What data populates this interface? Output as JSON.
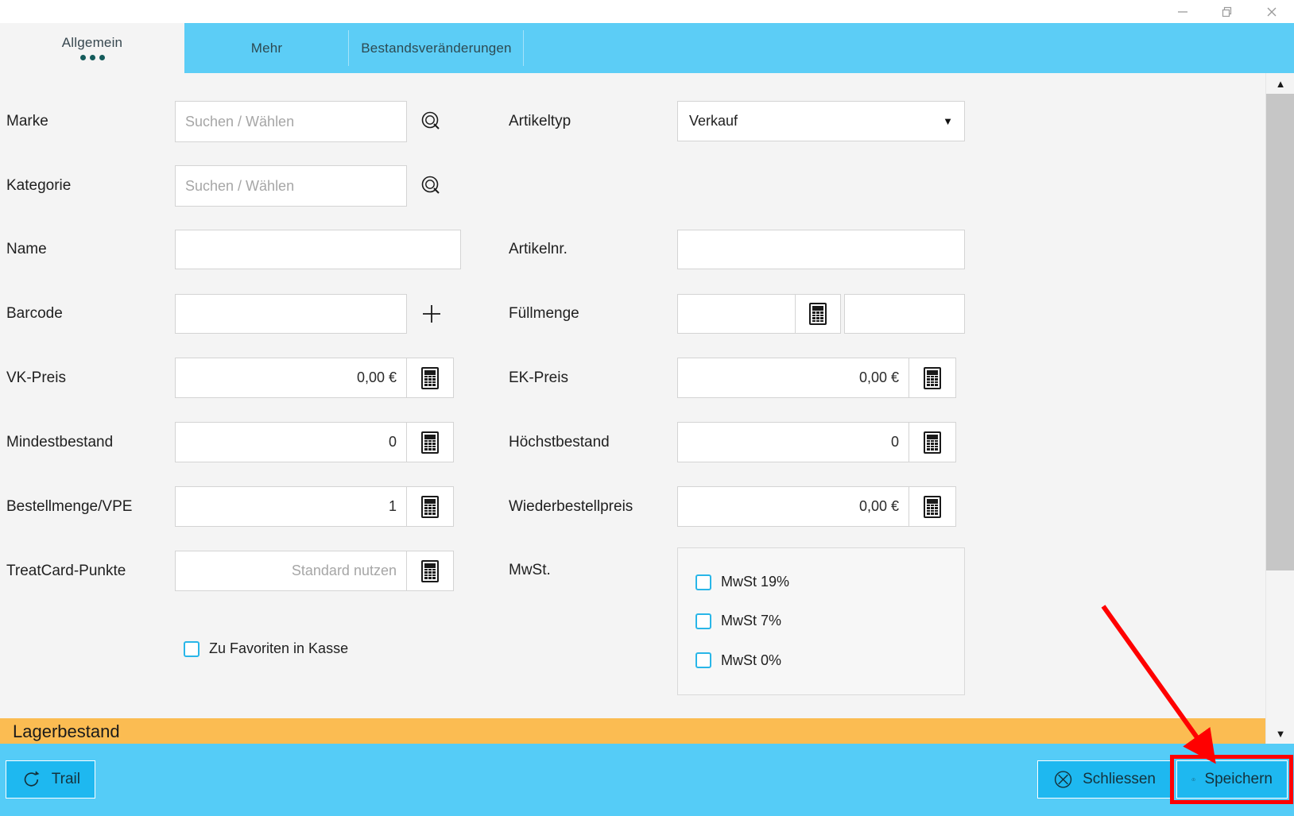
{
  "window": {
    "controls": [
      {
        "name": "minimize",
        "glyph": "minimize-icon"
      },
      {
        "name": "restore",
        "glyph": "restore-icon"
      },
      {
        "name": "close",
        "glyph": "close-icon"
      }
    ]
  },
  "tabs": [
    {
      "label": "Allgemein",
      "active": true,
      "dots": 3
    },
    {
      "label": "Mehr",
      "active": false
    },
    {
      "label": "Bestandsveränderungen",
      "active": false
    }
  ],
  "form": {
    "left": [
      {
        "label": "Marke",
        "value": "",
        "placeholder": "Suchen / Wählen",
        "trailing": "search-icon"
      },
      {
        "label": "Kategorie",
        "value": "",
        "placeholder": "Suchen / Wählen",
        "trailing": "search-icon"
      },
      {
        "label": "Name",
        "value": "",
        "placeholder": ""
      },
      {
        "label": "Barcode",
        "value": "",
        "placeholder": "",
        "trailing": "plus-icon"
      },
      {
        "label": "VK-Preis",
        "value": "0,00 €",
        "placeholder": "",
        "trailing": "calculator-icon"
      },
      {
        "label": "Mindestbestand",
        "value": "0",
        "placeholder": "",
        "trailing": "calculator-icon"
      },
      {
        "label": "Bestellmenge/VPE",
        "value": "1",
        "placeholder": "",
        "trailing": "calculator-icon"
      },
      {
        "label": "TreatCard-Punkte",
        "value": "",
        "placeholder": "Standard nutzen",
        "trailing": "calculator-icon"
      }
    ],
    "right": [
      {
        "label": "Artikeltyp",
        "value": "Verkauf",
        "type": "select"
      },
      {
        "label": "Artikelnr.",
        "value": "",
        "placeholder": ""
      },
      {
        "label": "Füllmenge",
        "value": "",
        "value2": "",
        "placeholder": "",
        "trailing": "calculator-icon"
      },
      {
        "label": "EK-Preis",
        "value": "0,00 €",
        "placeholder": "",
        "trailing": "calculator-icon"
      },
      {
        "label": "Höchstbestand",
        "value": "0",
        "placeholder": "",
        "trailing": "calculator-icon"
      },
      {
        "label": "Wiederbestellpreis",
        "value": "0,00 €",
        "placeholder": "",
        "trailing": "calculator-icon"
      },
      {
        "label": "MwSt.",
        "type": "checkbox-group"
      }
    ],
    "favorites_checkbox": {
      "label": "Zu Favoriten in Kasse",
      "checked": false
    },
    "mwst_options": [
      {
        "label": "MwSt 19%",
        "checked": false
      },
      {
        "label": "MwSt 7%",
        "checked": false
      },
      {
        "label": "MwSt 0%",
        "checked": false
      }
    ]
  },
  "banner": {
    "text": "Lagerbestand"
  },
  "footer": {
    "trail_label": "Trail",
    "close_label": "Schliessen",
    "save_label": "Speichern"
  },
  "colors": {
    "accent_blue": "#5ccdf6",
    "button_blue": "#1eb8f0",
    "banner_orange": "#fbbc52",
    "checkbox_blue": "#29b6e8",
    "annotation_red": "#ff0000",
    "page_bg": "#f4f4f4"
  }
}
